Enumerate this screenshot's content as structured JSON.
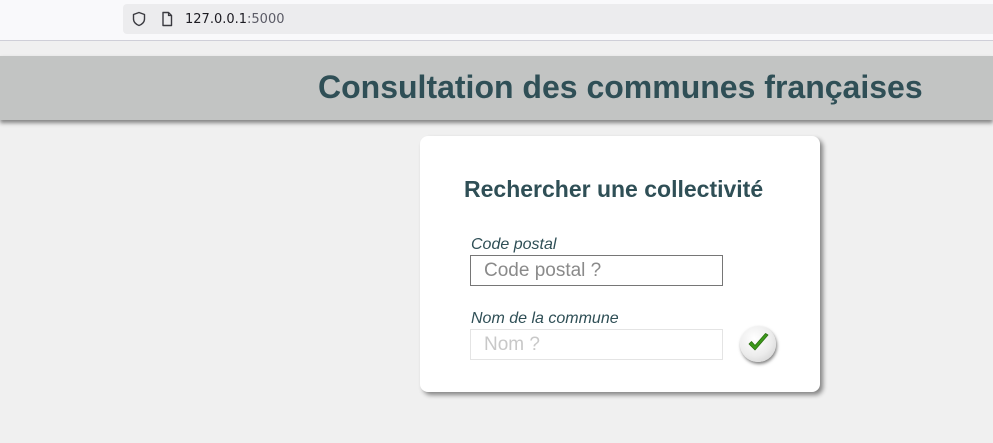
{
  "browser": {
    "url_host": "127.0.0.1",
    "url_port": ":5000"
  },
  "header": {
    "title": "Consultation des communes françaises"
  },
  "search_card": {
    "title": "Rechercher une collectivité",
    "postal_code": {
      "label": "Code postal",
      "placeholder": "Code postal ?",
      "value": ""
    },
    "commune_name": {
      "label": "Nom de la commune",
      "placeholder": "Nom ?",
      "value": ""
    },
    "submit_icon": "checkmark-icon"
  },
  "colors": {
    "title_text": "#2f4f56",
    "header_bg": "#c2c4c3",
    "check_green": "#3c9a1a"
  }
}
